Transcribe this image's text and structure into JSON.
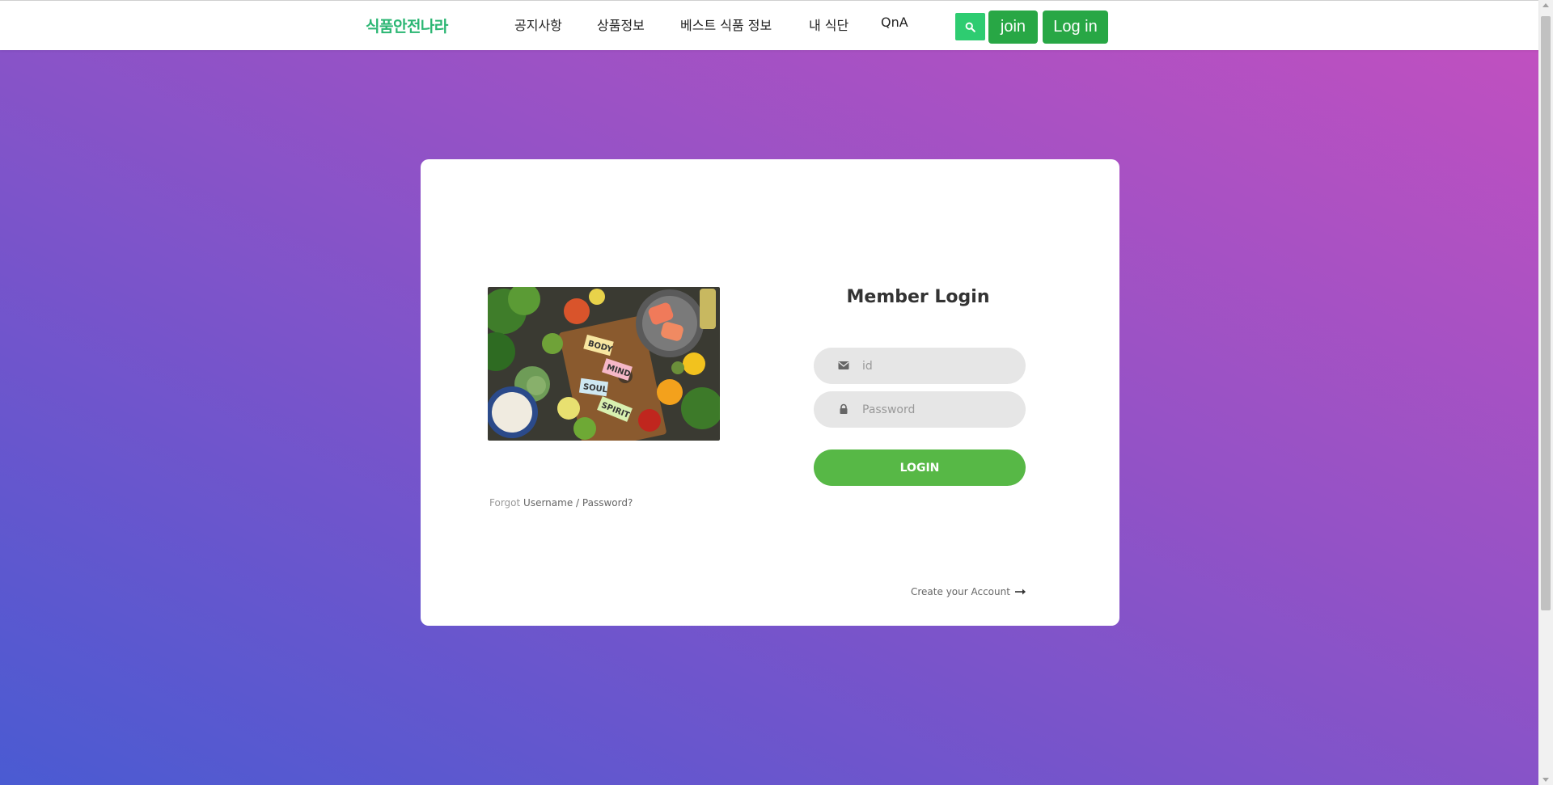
{
  "nav": {
    "brand": "식품안전나라",
    "items": [
      {
        "label": "공지사항"
      },
      {
        "label": "상품정보"
      },
      {
        "label": "베스트 식품 정보"
      },
      {
        "label": "내 식단"
      },
      {
        "label": "QnA"
      }
    ],
    "search_icon": "search-icon",
    "join_label": "join",
    "login_label": "Log in"
  },
  "login": {
    "title": "Member Login",
    "id_placeholder": "id",
    "password_placeholder": "Password",
    "submit_label": "LOGIN",
    "forgot_prefix": "Forgot",
    "forgot_username": "Username",
    "forgot_sep": "/",
    "forgot_password": "Password?",
    "create_account": "Create your Account",
    "image_tags": [
      "BODY",
      "MIND",
      "SOUL",
      "SPIRIT"
    ]
  },
  "colors": {
    "brand_green": "#2bb673",
    "button_green": "#28a745",
    "search_green": "#2ecc71",
    "login_green": "#57b846",
    "gradient_start": "#4a5bd2",
    "gradient_end": "#c050c0"
  }
}
